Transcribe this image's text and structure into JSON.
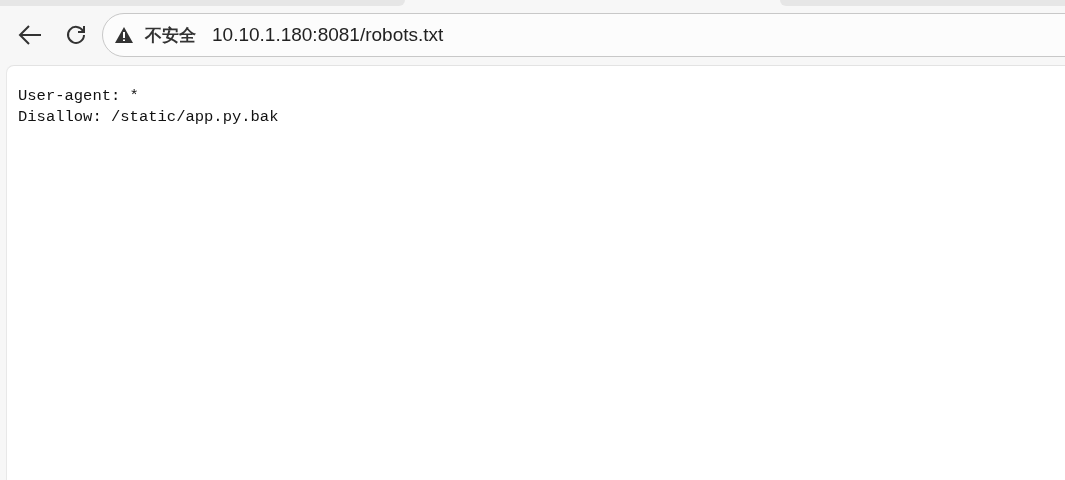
{
  "address_bar": {
    "security_label": "不安全",
    "url": "10.10.1.180:8081/robots.txt"
  },
  "page": {
    "lines": [
      "User-agent: *",
      "Disallow: /static/app.py.bak"
    ]
  }
}
